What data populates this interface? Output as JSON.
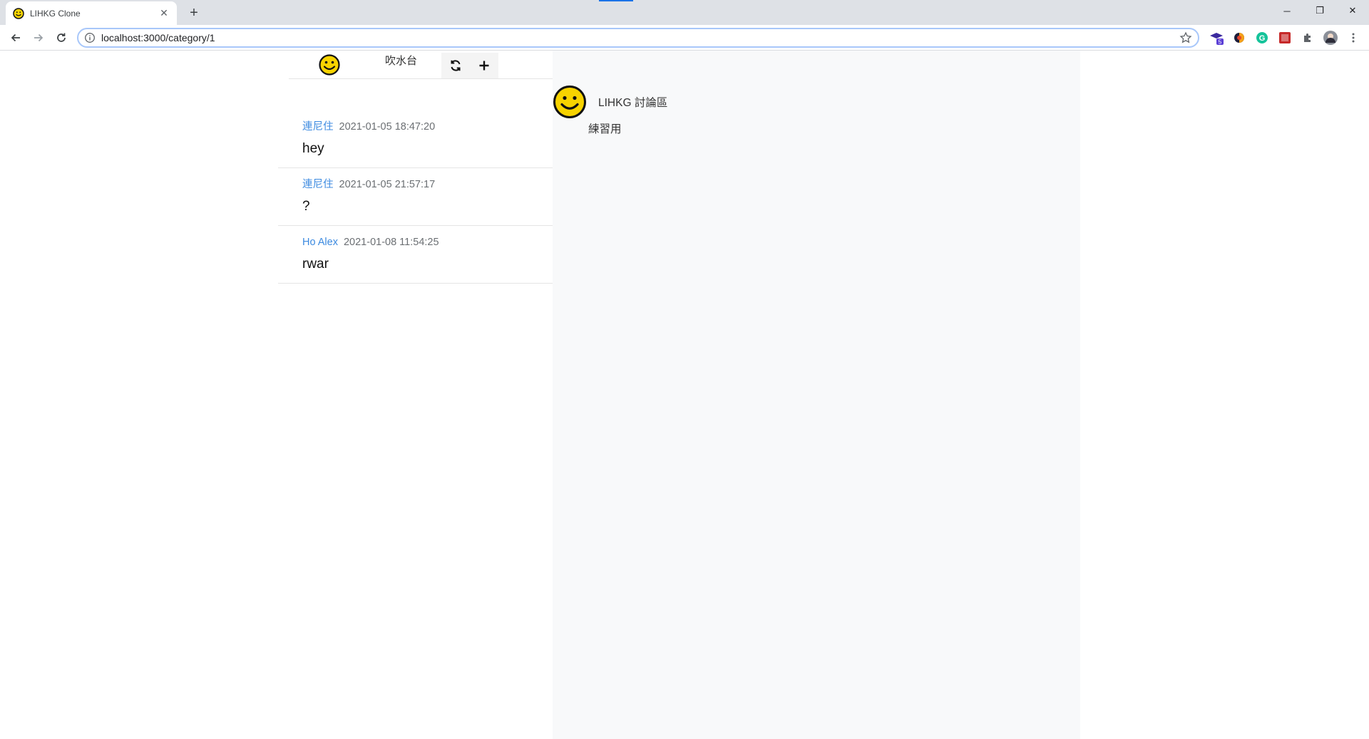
{
  "browser": {
    "tab_title": "LIHKG Clone",
    "tab_close": "✕",
    "new_tab": "+",
    "url": "localhost:3000/category/1",
    "win_minimize": "─",
    "win_restore": "❐",
    "win_close": "✕",
    "ext_badge": "5"
  },
  "topbar": {
    "category_title": "吹水台"
  },
  "threads": [
    {
      "author": "連尼住",
      "time": "2021-01-05 18:47:20",
      "subject": "hey"
    },
    {
      "author": "連尼住",
      "time": "2021-01-05 21:57:17",
      "subject": "?"
    },
    {
      "author": "Ho Alex",
      "time": "2021-01-08 11:54:25",
      "subject": "rwar"
    }
  ],
  "board": {
    "name": "LIHKG 討論區",
    "description": "練習用"
  },
  "colors": {
    "author_link": "#3c8ae0",
    "logo_yellow": "#f7d300",
    "right_panel_bg": "#f8f9fa"
  }
}
